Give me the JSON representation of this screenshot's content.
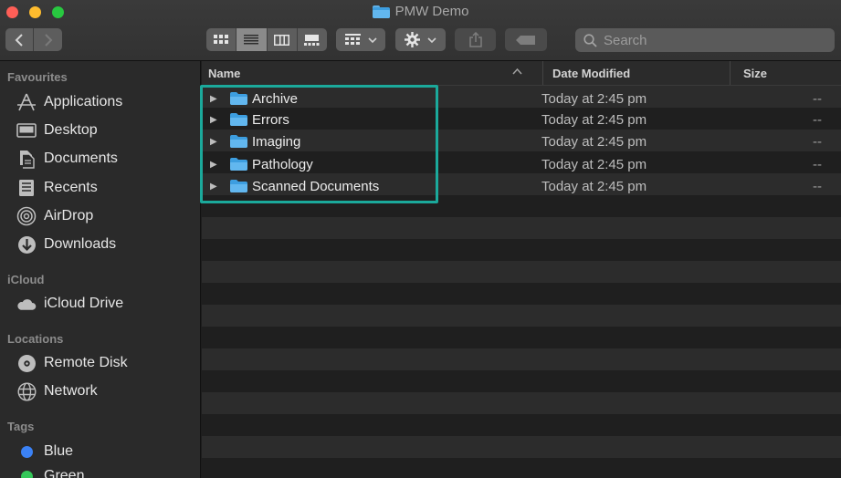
{
  "window": {
    "title": "PMW Demo",
    "title_icon": "folder-icon"
  },
  "toolbar": {
    "back_label": "‹",
    "forward_label": "›",
    "view_modes": [
      "icon-view-icon",
      "list-view-icon",
      "column-view-icon",
      "gallery-view-icon"
    ],
    "active_view": "list",
    "group_icon": "group-icon",
    "action_icon": "gear-icon",
    "share_icon": "share-icon",
    "tag_icon": "tag-icon",
    "search_placeholder": "Search"
  },
  "sidebar": {
    "favourites_header": "Favourites",
    "favourites": [
      {
        "label": "Applications",
        "icon": "applications-icon"
      },
      {
        "label": "Desktop",
        "icon": "desktop-icon"
      },
      {
        "label": "Documents",
        "icon": "documents-icon"
      },
      {
        "label": "Recents",
        "icon": "recents-icon"
      },
      {
        "label": "AirDrop",
        "icon": "airdrop-icon"
      },
      {
        "label": "Downloads",
        "icon": "downloads-icon"
      }
    ],
    "icloud_header": "iCloud",
    "icloud": [
      {
        "label": "iCloud Drive",
        "icon": "cloud-icon"
      }
    ],
    "locations_header": "Locations",
    "locations": [
      {
        "label": "Remote Disk",
        "icon": "disc-icon"
      },
      {
        "label": "Network",
        "icon": "network-icon"
      }
    ],
    "tags_header": "Tags",
    "tags": [
      {
        "label": "Blue",
        "color": "#3b82f6"
      },
      {
        "label": "Green",
        "color": "#34c759"
      }
    ]
  },
  "columns": {
    "name": "Name",
    "date_modified": "Date Modified",
    "size": "Size"
  },
  "files": [
    {
      "name": "Archive",
      "date": "Today at 2:45 pm",
      "size": "--"
    },
    {
      "name": "Errors",
      "date": "Today at 2:45 pm",
      "size": "--"
    },
    {
      "name": "Imaging",
      "date": "Today at 2:45 pm",
      "size": "--"
    },
    {
      "name": "Pathology",
      "date": "Today at 2:45 pm",
      "size": "--"
    },
    {
      "name": "Scanned Documents",
      "date": "Today at 2:45 pm",
      "size": "--"
    }
  ],
  "colors": {
    "highlight": "#1ba99b",
    "folder": "#3d9ee0"
  }
}
